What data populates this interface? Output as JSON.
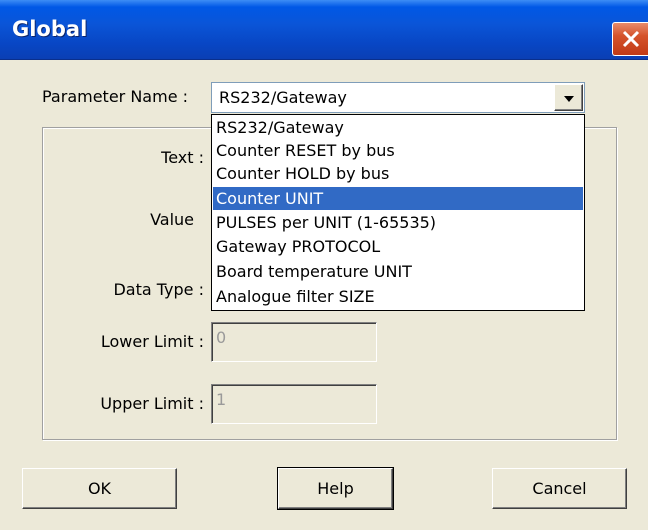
{
  "window": {
    "title": "Global",
    "close_icon": "close-icon"
  },
  "parameter": {
    "label": "Parameter Name :",
    "selected": "RS232/Gateway",
    "options": [
      "RS232/Gateway",
      "Counter RESET by bus",
      "Counter HOLD  by bus",
      "Counter UNIT",
      "PULSES per UNIT (1-65535)",
      "Gateway PROTOCOL",
      "Board temperature UNIT",
      "Analogue filter SIZE"
    ],
    "highlighted": "Counter UNIT"
  },
  "fields": {
    "text_label": "Text :",
    "value_label": "Value",
    "data_type_label": "Data Type :",
    "lower_limit_label": "Lower Limit :",
    "lower_limit_value": "0",
    "upper_limit_label": "Upper Limit :",
    "upper_limit_value": "1"
  },
  "buttons": {
    "ok": "OK",
    "help": "Help",
    "cancel": "Cancel"
  },
  "colors": {
    "titlebar": "#0a55d8",
    "selection": "#316ac5",
    "close": "#d5532b"
  }
}
